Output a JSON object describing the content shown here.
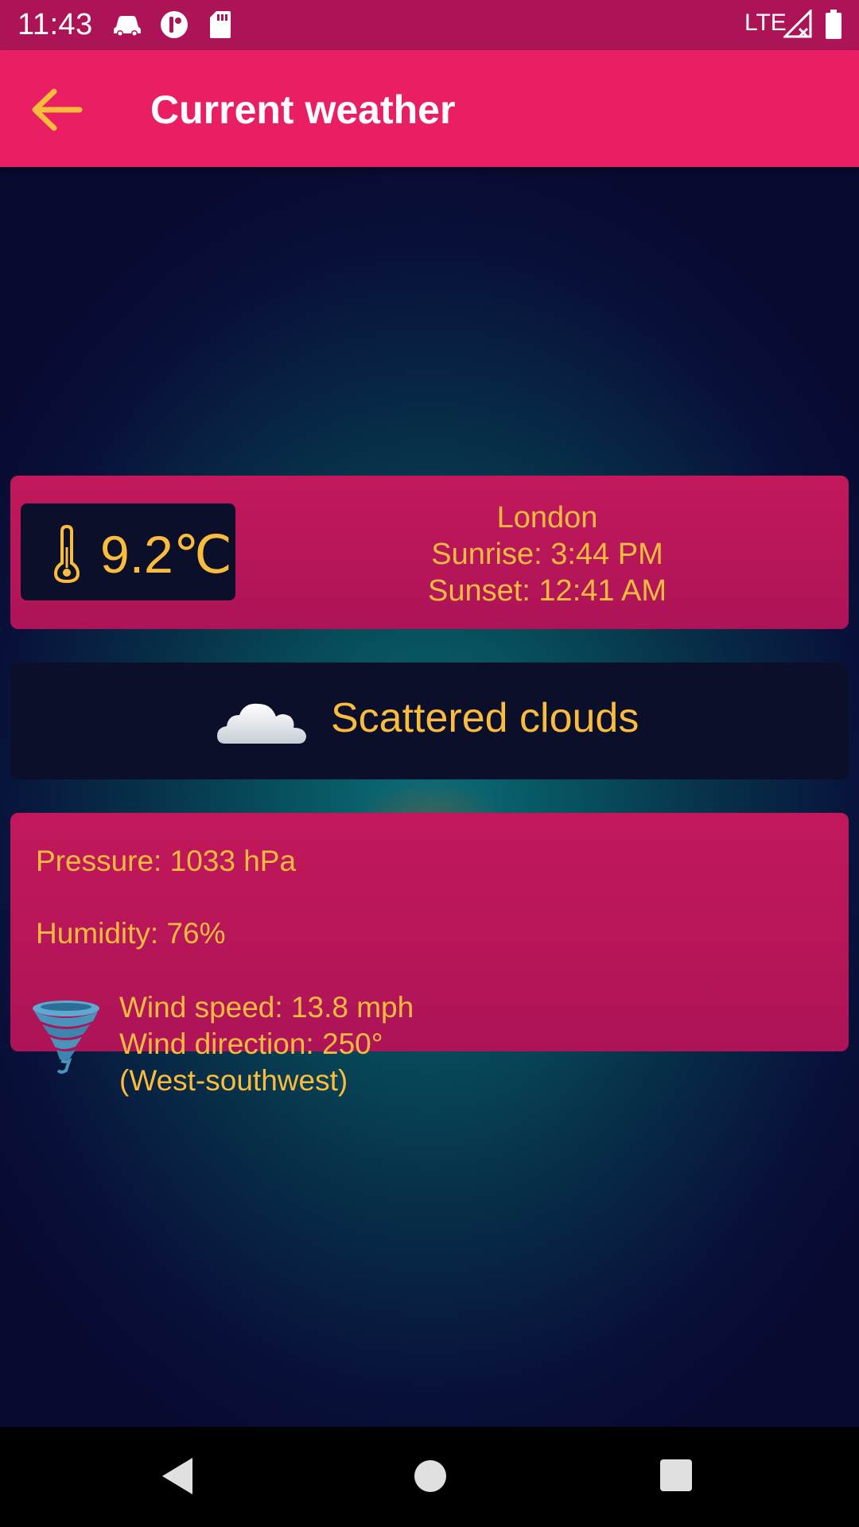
{
  "status_bar": {
    "time": "11:43",
    "network": "LTE",
    "icons": [
      "car-icon",
      "notification-app-icon",
      "sd-card-icon",
      "signal-icon",
      "battery-icon"
    ]
  },
  "app_bar": {
    "title": "Current weather",
    "back_icon": "arrow-back-icon"
  },
  "temperature": {
    "value": "9.2℃",
    "icon": "thermometer-icon"
  },
  "location": {
    "city": "London",
    "sunrise": "Sunrise: 3:44 PM",
    "sunset": "Sunset: 12:41 AM"
  },
  "condition": {
    "text": "Scattered clouds",
    "icon": "cloud-icon"
  },
  "details": {
    "pressure": "Pressure: 1033 hPa",
    "humidity": "Humidity: 76%",
    "wind_speed": "Wind speed: 13.8 mph",
    "wind_direction": "Wind direction: 250°",
    "wind_direction_name": "(West-southwest)",
    "wind_icon": "tornado-icon"
  },
  "nav_bar": {
    "buttons": [
      "back-nav-icon",
      "home-nav-icon",
      "recents-nav-icon"
    ]
  },
  "colors": {
    "status_bar": "#ad1457",
    "app_bar": "#e91e63",
    "accent_text": "#f9bc3c",
    "card_pink": "#c2185b",
    "card_dark": "#0c0f2a"
  }
}
